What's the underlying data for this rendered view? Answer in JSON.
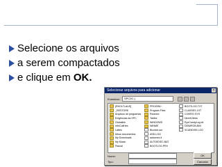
{
  "bullets": [
    {
      "text": "Selecione os arquivos"
    },
    {
      "text": "a serem compactados"
    },
    {
      "pre": "e clique em ",
      "bold": "OK."
    }
  ],
  "dialog": {
    "title": "Selecionar arquivos para adicionar",
    "look_in_label": "Examinar:",
    "look_in_value": "SPC3C:)",
    "col1": [
      "[RHOLTLAUS]",
      "_RESTORE",
      "Arquivos de programas",
      "Exigências da SPC",
      "Globalink",
      "InfoCollHes",
      "Lattes",
      "Meus documentos",
      "My Downloads",
      "My Music",
      "Pascal"
    ],
    "col2": [
      "PROGRA~",
      "Program Files",
      "Recmed",
      "Tables",
      "WINDOWS",
      "WINME",
      "Bloxlidr.ocx",
      "ASD.LOG",
      "autoexec.ll",
      "AUTOEXEC.BAT",
      "BOOTLOG.PRV"
    ],
    "col3": [
      "BOOTLOG.TXT",
      "CLASSES.1ST",
      "CONFIG.SYS",
      "DirectViews",
      "EyeCandyLog.txt",
      "DEMIRON.BIN",
      "SCANDISK.LOG"
    ],
    "file_name_label": "Nome:",
    "file_type_label": "Tipo:",
    "ok_label": "OK",
    "cancel_label": "Cancelar"
  }
}
